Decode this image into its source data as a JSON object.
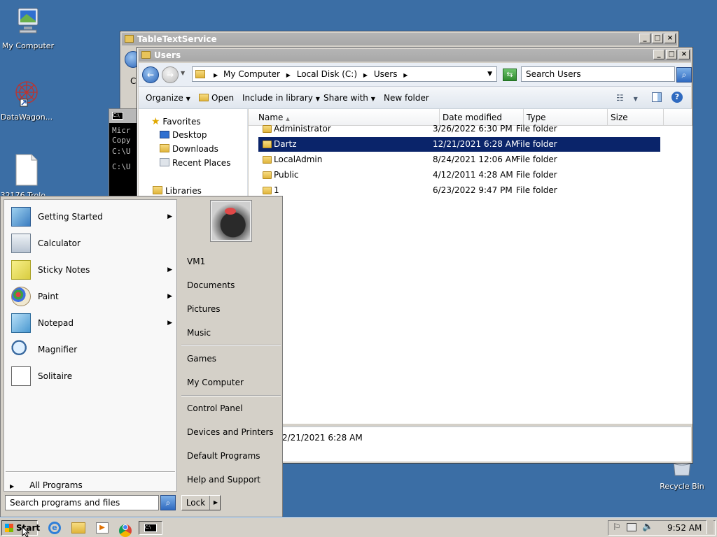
{
  "desktop": {
    "icons": [
      {
        "label": "My Computer"
      },
      {
        "label": "DataWagon..."
      },
      {
        "label": "32176.Trolo..."
      },
      {
        "label": "Recycle Bin"
      }
    ]
  },
  "back_window": {
    "title": "TableTextService",
    "partial_text": "C"
  },
  "console": {
    "lines": [
      "Micr",
      "Copy",
      "C:\\U",
      "C:\\U"
    ]
  },
  "explorer": {
    "title": "Users",
    "address": {
      "segments": [
        "My Computer",
        "Local Disk (C:)",
        "Users"
      ]
    },
    "search_placeholder": "Search Users",
    "commands": {
      "organize": "Organize",
      "open": "Open",
      "include": "Include in library",
      "share": "Share with",
      "new_folder": "New folder"
    },
    "nav": {
      "favorites": "Favorites",
      "items": [
        "Desktop",
        "Downloads",
        "Recent Places"
      ],
      "libraries": "Libraries"
    },
    "columns": [
      "Name",
      "Date modified",
      "Type",
      "Size"
    ],
    "rows": [
      {
        "name": "Administrator",
        "date": "3/26/2022 6:30 PM",
        "type": "File folder",
        "selected": false
      },
      {
        "name": "Dartz",
        "date": "12/21/2021 6:28 AM",
        "type": "File folder",
        "selected": true
      },
      {
        "name": "LocalAdmin",
        "date": "8/24/2021 12:06 AM",
        "type": "File folder",
        "selected": false
      },
      {
        "name": "Public",
        "date": "4/12/2011 4:28 AM",
        "type": "File folder",
        "selected": false
      },
      {
        "name": "1",
        "date": "6/23/2022 9:47 PM",
        "type": "File folder",
        "selected": false
      }
    ],
    "details_text": "2/21/2021 6:28 AM"
  },
  "start_menu": {
    "programs": [
      {
        "label": "Getting Started",
        "has_arrow": true
      },
      {
        "label": "Calculator",
        "has_arrow": false
      },
      {
        "label": "Sticky Notes",
        "has_arrow": true
      },
      {
        "label": "Paint",
        "has_arrow": true
      },
      {
        "label": "Notepad",
        "has_arrow": true
      },
      {
        "label": "Magnifier",
        "has_arrow": false
      },
      {
        "label": "Solitaire",
        "has_arrow": false
      }
    ],
    "all_programs": "All Programs",
    "search_placeholder": "Search programs and files",
    "right_items": {
      "user": "VM1",
      "documents": "Documents",
      "pictures": "Pictures",
      "music": "Music",
      "games": "Games",
      "computer": "My Computer",
      "control_panel": "Control Panel",
      "devices": "Devices and Printers",
      "default_programs": "Default Programs",
      "help": "Help and Support"
    },
    "lock_label": "Lock"
  },
  "taskbar": {
    "start_label": "Start",
    "clock": "9:52 AM"
  },
  "colors": {
    "desktop": "#3b6ea5",
    "selection": "#0a246a"
  }
}
